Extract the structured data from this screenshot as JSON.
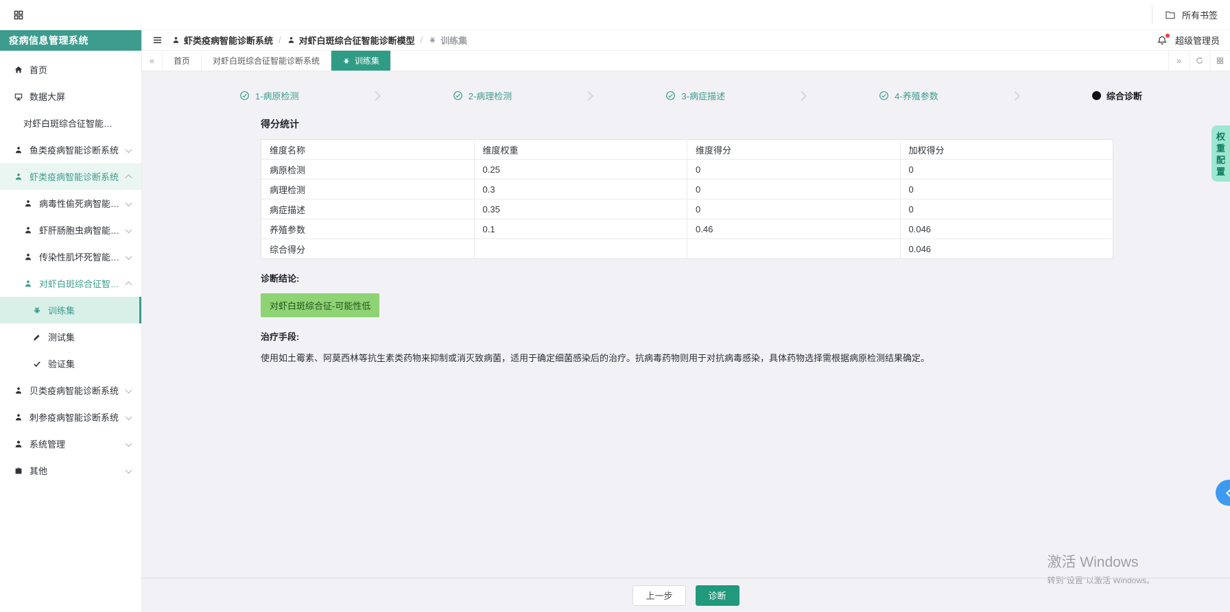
{
  "browser": {
    "bookmarks": "所有书签"
  },
  "colors": {
    "primary": "#3d9c8d",
    "tab_active": "#2f9c86",
    "button": "#21997d",
    "badge_bg": "#8ed374",
    "fab_blue": "#3d9af0"
  },
  "sidebar": {
    "title": "疫病信息管理系统",
    "items": [
      {
        "label": "首页",
        "icon": "home",
        "level": 0
      },
      {
        "label": "数据大屏",
        "icon": "monitor",
        "level": 0
      },
      {
        "label": "对虾白斑综合征智能诊断系统",
        "icon": "none",
        "level": 1
      },
      {
        "label": "鱼类疫病智能诊断系统",
        "icon": "station",
        "level": 0,
        "chevron": "down"
      },
      {
        "label": "虾类疫病智能诊断系统",
        "icon": "station",
        "level": 0,
        "chevron": "up",
        "active": true,
        "tinted": true
      },
      {
        "label": "病毒性偷死病智能诊断模型",
        "icon": "station",
        "level": 1,
        "chevron": "down"
      },
      {
        "label": "虾肝肠胞虫病智能诊断模型",
        "icon": "station",
        "level": 1,
        "chevron": "down"
      },
      {
        "label": "传染性肌坏死智能诊断模型",
        "icon": "station",
        "level": 1,
        "chevron": "down"
      },
      {
        "label": "对虾白斑综合征智能诊断模型",
        "icon": "station",
        "level": 1,
        "chevron": "up",
        "active": true
      },
      {
        "label": "训练集",
        "icon": "android",
        "level": 2,
        "selected": true,
        "active": true
      },
      {
        "label": "测试集",
        "icon": "pencil",
        "level": 2
      },
      {
        "label": "验证集",
        "icon": "check",
        "level": 2
      },
      {
        "label": "贝类疫病智能诊断系统",
        "icon": "station",
        "level": 0,
        "chevron": "down"
      },
      {
        "label": "刺参疫病智能诊断系统",
        "icon": "station",
        "level": 0,
        "chevron": "down"
      },
      {
        "label": "系统管理",
        "icon": "user",
        "level": 0,
        "chevron": "down"
      },
      {
        "label": "其他",
        "icon": "briefcase",
        "level": 0,
        "chevron": "down"
      }
    ]
  },
  "header": {
    "breadcrumb": [
      {
        "label": "虾类疫病智能诊断系统",
        "icon": "station"
      },
      {
        "label": "对虾白斑综合征智能诊断模型",
        "icon": "station"
      },
      {
        "label": "训练集",
        "icon": "android",
        "muted": true
      }
    ],
    "user": "超级管理员"
  },
  "tabbar": {
    "tabs": [
      {
        "label": "首页"
      },
      {
        "label": "对虾白斑综合征智能诊断系统"
      },
      {
        "label": "训练集",
        "icon": "android",
        "active": true
      }
    ]
  },
  "stepper": [
    {
      "label": "1-病原检测",
      "state": "done"
    },
    {
      "label": "2-病理检测",
      "state": "done"
    },
    {
      "label": "3-病症描述",
      "state": "done"
    },
    {
      "label": "4-养殖参数",
      "state": "done"
    },
    {
      "label": "综合诊断",
      "state": "current"
    }
  ],
  "panel": {
    "score_title": "得分统计",
    "table": {
      "headers": [
        "维度名称",
        "维度权重",
        "维度得分",
        "加权得分"
      ],
      "rows": [
        [
          "病原检测",
          "0.25",
          "0",
          "0"
        ],
        [
          "病理检测",
          "0.3",
          "0",
          "0"
        ],
        [
          "病症描述",
          "0.35",
          "0",
          "0"
        ],
        [
          "养殖参数",
          "0.1",
          "0.46",
          "0.046"
        ],
        [
          "综合得分",
          "",
          "",
          "0.046"
        ]
      ]
    },
    "diagnosis_label": "诊断结论:",
    "diagnosis_badge": "对虾白斑综合征-可能性低",
    "treatment_label": "治疗手段:",
    "treatment_text": "使用如土霉素、阿莫西林等抗生素类药物来抑制或消灭致病菌，适用于确定细菌感染后的治疗。抗病毒药物则用于对抗病毒感染，具体药物选择需根据病原检测结果确定。",
    "prev_button": "上一步",
    "diagnose_button": "诊断"
  },
  "right": {
    "weight_config": "权重配置"
  },
  "watermark": {
    "line1": "激活 Windows",
    "line2": "转到\"设置\"以激活 Windows。"
  }
}
